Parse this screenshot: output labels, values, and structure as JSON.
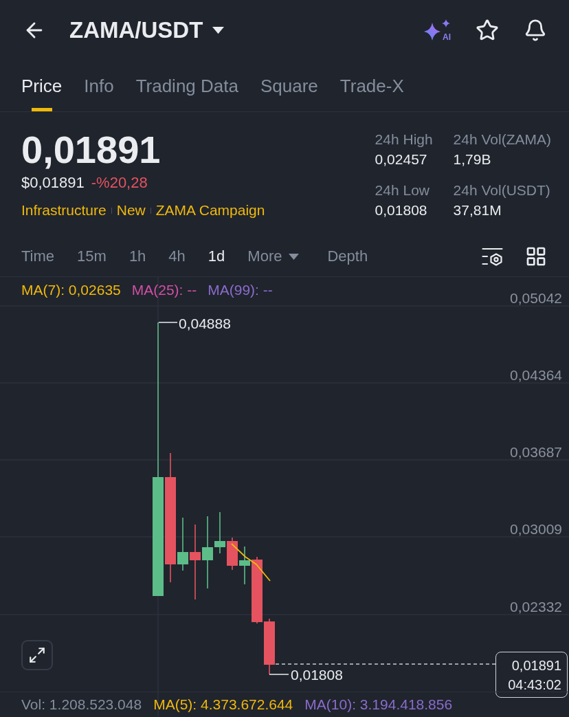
{
  "header": {
    "title": "ZAMA/USDT",
    "ai_label": "AI"
  },
  "tabs": [
    {
      "label": "Price",
      "selected": true
    },
    {
      "label": "Info",
      "selected": false
    },
    {
      "label": "Trading Data",
      "selected": false
    },
    {
      "label": "Square",
      "selected": false
    },
    {
      "label": "Trade-X",
      "selected": false
    }
  ],
  "ticker": {
    "price": "0,01891",
    "price_usd": "$0,01891",
    "change": "-%20,28",
    "tags": [
      "Infrastructure",
      "New",
      "ZAMA Campaign"
    ]
  },
  "stats": [
    {
      "label": "24h High",
      "value": "0,02457"
    },
    {
      "label": "24h Vol(ZAMA)",
      "value": "1,79B"
    },
    {
      "label": "24h Low",
      "value": "0,01808"
    },
    {
      "label": "24h Vol(USDT)",
      "value": "37,81M"
    }
  ],
  "intervals": [
    {
      "label": "Time",
      "kind": "option",
      "selected": false
    },
    {
      "label": "15m",
      "kind": "option",
      "selected": false
    },
    {
      "label": "1h",
      "kind": "option",
      "selected": false
    },
    {
      "label": "4h",
      "kind": "option",
      "selected": false
    },
    {
      "label": "1d",
      "kind": "option",
      "selected": true
    },
    {
      "label": "More",
      "kind": "dropdown",
      "selected": false
    },
    {
      "label": "Depth",
      "kind": "option",
      "selected": false
    }
  ],
  "chart": {
    "indicators": [
      {
        "label": "MA(7): 0,02635",
        "color": "#f0b90b"
      },
      {
        "label": "MA(25): --",
        "color": "#d14fa5"
      },
      {
        "label": "MA(99): --",
        "color": "#8a6ccc"
      }
    ],
    "y_axis": [
      "0,05042",
      "0,04364",
      "0,03687",
      "0,03009",
      "0,02332"
    ],
    "high_label": "0,04888",
    "low_label": "0,01808",
    "last_price": "0,01891",
    "countdown": "04:43:02"
  },
  "volume": {
    "label": "Vol: 1.208.523.048",
    "indicators": [
      {
        "label": "MA(5): 4.373.672.644",
        "color": "#f0b90b"
      },
      {
        "label": "MA(10): 3.194.418.856",
        "color": "#8a6ccc"
      }
    ]
  }
}
